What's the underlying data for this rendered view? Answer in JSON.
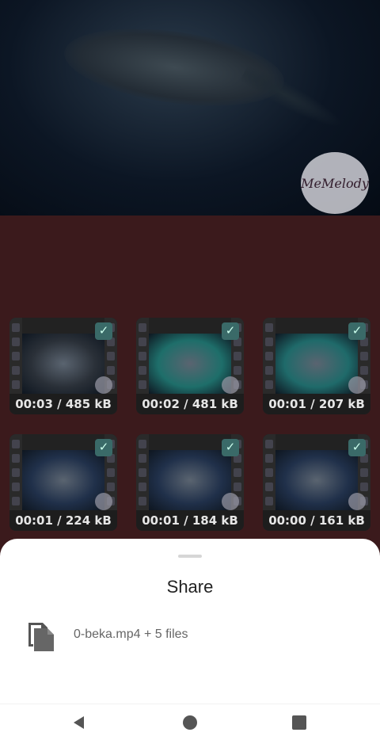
{
  "preview": {
    "watermark_text": "MeMelody"
  },
  "thumbnails": [
    {
      "caption": "00:03 / 485 kB",
      "tint": "#2a3038",
      "checked": true
    },
    {
      "caption": "00:02 / 481 kB",
      "tint": "#1e6e6a",
      "checked": true
    },
    {
      "caption": "00:01 / 207 kB",
      "tint": "#1f6a6a",
      "checked": true
    },
    {
      "caption": "00:01 / 224 kB",
      "tint": "#20304a",
      "checked": true
    },
    {
      "caption": "00:01 / 184 kB",
      "tint": "#20304a",
      "checked": true
    },
    {
      "caption": "00:00 / 161 kB",
      "tint": "#20304a",
      "checked": true
    }
  ],
  "share_sheet": {
    "title": "Share",
    "file_summary": "0-beka.mp4 + 5 files",
    "file_icon": "copy-files-icon"
  },
  "navbar": {
    "back_icon": "back-triangle-icon",
    "home_icon": "home-circle-icon",
    "recents_icon": "recents-square-icon"
  },
  "colors": {
    "scrim_background": "#3b1a1c",
    "check_badge": "#3a6a68",
    "sheet_background": "#ffffff"
  }
}
